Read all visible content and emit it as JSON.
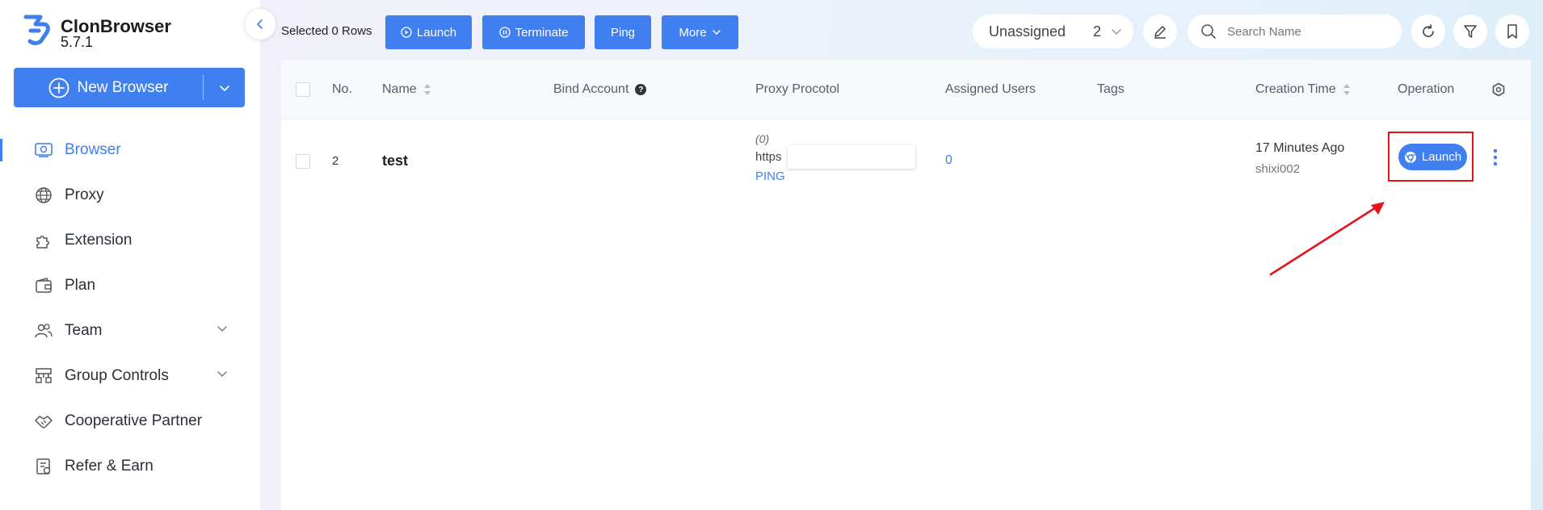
{
  "app": {
    "name": "ClonBrowser",
    "version": "5.7.1"
  },
  "sidebar": {
    "new_browser_label": "New Browser",
    "items": [
      {
        "label": "Browser",
        "icon": "browser-icon",
        "active": true
      },
      {
        "label": "Proxy",
        "icon": "globe-icon"
      },
      {
        "label": "Extension",
        "icon": "puzzle-icon"
      },
      {
        "label": "Plan",
        "icon": "wallet-icon"
      },
      {
        "label": "Team",
        "icon": "team-icon",
        "expandable": true
      },
      {
        "label": "Group Controls",
        "icon": "sitemap-icon",
        "expandable": true
      },
      {
        "label": "Cooperative Partner",
        "icon": "handshake-icon"
      },
      {
        "label": "Refer & Earn",
        "icon": "invoice-icon"
      }
    ]
  },
  "toolbar": {
    "selected_text": "Selected 0 Rows",
    "launch_label": "Launch",
    "terminate_label": "Terminate",
    "ping_label": "Ping",
    "more_label": "More",
    "group_label": "Unassigned",
    "group_count": "2",
    "search_placeholder": "Search Name"
  },
  "table": {
    "columns": {
      "no": "No.",
      "name": "Name",
      "bind_account": "Bind Account",
      "proxy_protocol": "Proxy Procotol",
      "assigned_users": "Assigned Users",
      "tags": "Tags",
      "creation_time": "Creation Time",
      "operation": "Operation"
    },
    "rows": [
      {
        "no": "2",
        "name": "test",
        "proxy_count": "(0)",
        "proxy_type": "https",
        "ping_label": "PING",
        "assigned_users": "0",
        "creation_time": "17 Minutes Ago",
        "creator": "shixi002",
        "launch_label": "Launch"
      }
    ]
  },
  "colors": {
    "accent": "#3f7ff0",
    "highlight": "#e8121b",
    "header_bg": "#f6f9fc"
  }
}
